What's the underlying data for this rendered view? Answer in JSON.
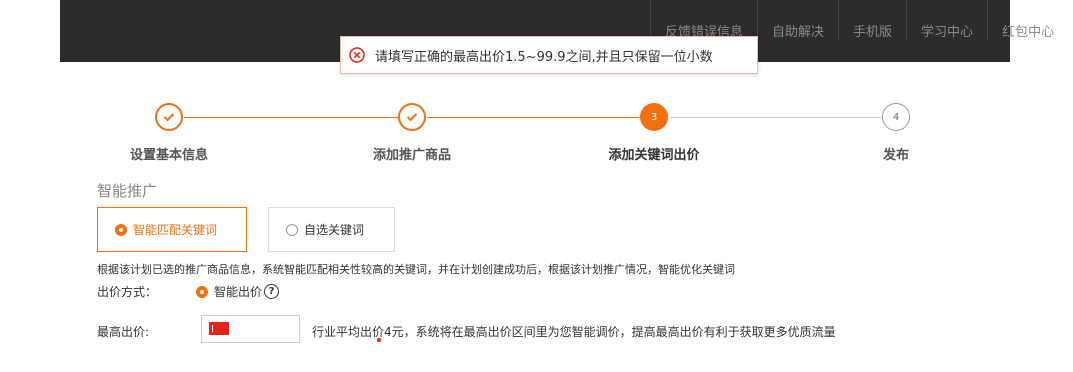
{
  "colors": {
    "accent": "#f36f0f",
    "error": "#e8231a",
    "topbar": "#2c2c2c"
  },
  "topnav": [
    "反馈错误信息",
    "自助解决",
    "手机版",
    "学习中心",
    "红包中心"
  ],
  "toast": {
    "icon": "error-circle-icon",
    "text": "请填写正确的最高出价1.5~99.9之间,并且只保留一位小数"
  },
  "steps": [
    {
      "label": "设置基本信息",
      "status": "done"
    },
    {
      "label": "添加推广商品",
      "status": "done"
    },
    {
      "label": "添加关键词出价",
      "status": "active",
      "number": "3"
    },
    {
      "label": "发布",
      "status": "todo",
      "number": "4"
    }
  ],
  "section_title": "智能推广",
  "modes": {
    "smart": "智能匹配关键词",
    "custom": "自选关键词"
  },
  "description": "根据该计划已选的推广商品信息，系统智能匹配相关性较高的关键词，并在计划创建成功后，根据该计划推广情况，智能优化关键词",
  "bid_method": {
    "label": "出价方式：",
    "option": "智能出价",
    "help": "?"
  },
  "max_bid": {
    "label": "最高出价:",
    "value": "",
    "hint": "行业平均出价4元，系统将在最高出价区间里为您智能调价，提高最高出价有利于获取更多优质流量"
  }
}
